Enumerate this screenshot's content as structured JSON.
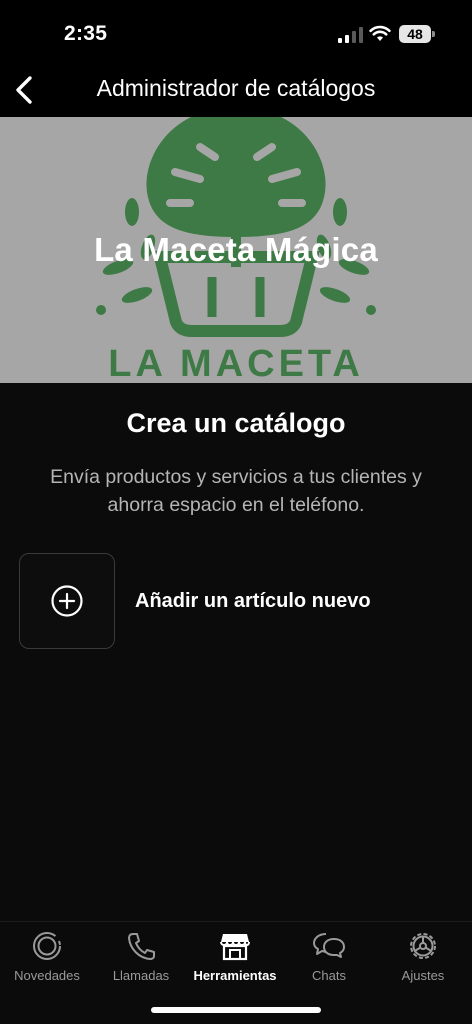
{
  "status_bar": {
    "time": "2:35",
    "battery": "48",
    "icons": [
      "signal-icon",
      "wifi-icon",
      "battery-icon"
    ]
  },
  "nav": {
    "title": "Administrador de catálogos",
    "back_icon": "chevron-left-icon"
  },
  "banner": {
    "title": "La Maceta Mágica",
    "brand_text": "LA MACETA",
    "background_color": "#a6a6a6",
    "logo_color": "#3e7a45"
  },
  "content": {
    "heading": "Crea un catálogo",
    "description": "Envía productos y servicios a tus clientes y ahorra espacio en el teléfono.",
    "add_item_label": "Añadir un artículo nuevo",
    "add_icon": "plus-circle-icon"
  },
  "tab_bar": {
    "tabs": [
      {
        "label": "Novedades",
        "icon": "status-icon",
        "active": false
      },
      {
        "label": "Llamadas",
        "icon": "phone-icon",
        "active": false
      },
      {
        "label": "Herramientas",
        "icon": "store-icon",
        "active": true
      },
      {
        "label": "Chats",
        "icon": "chat-bubbles-icon",
        "active": false
      },
      {
        "label": "Ajustes",
        "icon": "gear-icon",
        "active": false
      }
    ]
  }
}
